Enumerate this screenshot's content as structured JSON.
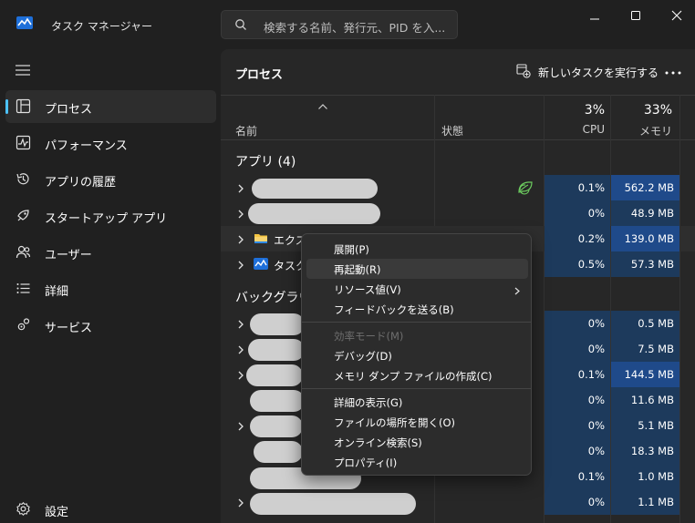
{
  "app": {
    "title": "タスク マネージャー",
    "search_placeholder": "検索する名前、発行元、PID を入..."
  },
  "nav": {
    "items": [
      {
        "label": "プロセス",
        "icon": "processes-icon",
        "active": true
      },
      {
        "label": "パフォーマンス",
        "icon": "performance-icon"
      },
      {
        "label": "アプリの履歴",
        "icon": "app-history-icon"
      },
      {
        "label": "スタートアップ アプリ",
        "icon": "startup-icon"
      },
      {
        "label": "ユーザー",
        "icon": "users-icon"
      },
      {
        "label": "詳細",
        "icon": "details-icon"
      },
      {
        "label": "サービス",
        "icon": "services-icon"
      }
    ],
    "settings_label": "設定"
  },
  "header": {
    "title": "プロセス",
    "run_task": "新しいタスクを実行する"
  },
  "columns": {
    "name": "名前",
    "status": "状態",
    "cpu_pct": "3%",
    "cpu": "CPU",
    "mem_pct": "33%",
    "mem": "メモリ"
  },
  "groups": {
    "apps": "アプリ (4)",
    "background": "バックグラウ"
  },
  "rows": {
    "apps": [
      {
        "name": "",
        "cpu": "0.1%",
        "mem": "562.2 MB",
        "efficiency_icon": "leaf-icon"
      },
      {
        "name": "",
        "cpu": "0%",
        "mem": "48.9 MB"
      },
      {
        "name": "エクスプ",
        "icon": "folder-icon",
        "cpu": "0.2%",
        "mem": "139.0 MB"
      },
      {
        "name": "タスク",
        "icon": "task-manager-icon",
        "cpu": "0.5%",
        "mem": "57.3 MB"
      }
    ],
    "background": [
      {
        "cpu": "0%",
        "mem": "0.5 MB"
      },
      {
        "cpu": "0%",
        "mem": "7.5 MB"
      },
      {
        "cpu": "0.1%",
        "mem": "144.5 MB"
      },
      {
        "cpu": "0%",
        "mem": "11.6 MB"
      },
      {
        "cpu": "0%",
        "mem": "5.1 MB"
      },
      {
        "cpu": "0%",
        "mem": "18.3 MB"
      },
      {
        "cpu": "0.1%",
        "mem": "1.0 MB"
      },
      {
        "cpu": "0%",
        "mem": "1.1 MB"
      }
    ]
  },
  "context_menu": {
    "items": [
      "展開(P)",
      "再起動(R)",
      "リソース値(V)",
      "フィードバックを送る(B)",
      "効率モード(M)",
      "デバッグ(D)",
      "メモリ ダンプ ファイルの作成(C)",
      "詳細の表示(G)",
      "ファイルの場所を開く(O)",
      "オンライン検索(S)",
      "プロパティ(I)"
    ]
  },
  "colors": {
    "accent": "#4cc2ff",
    "heat_low": "#1d3a5c",
    "heat_high": "#1f4a8a"
  }
}
